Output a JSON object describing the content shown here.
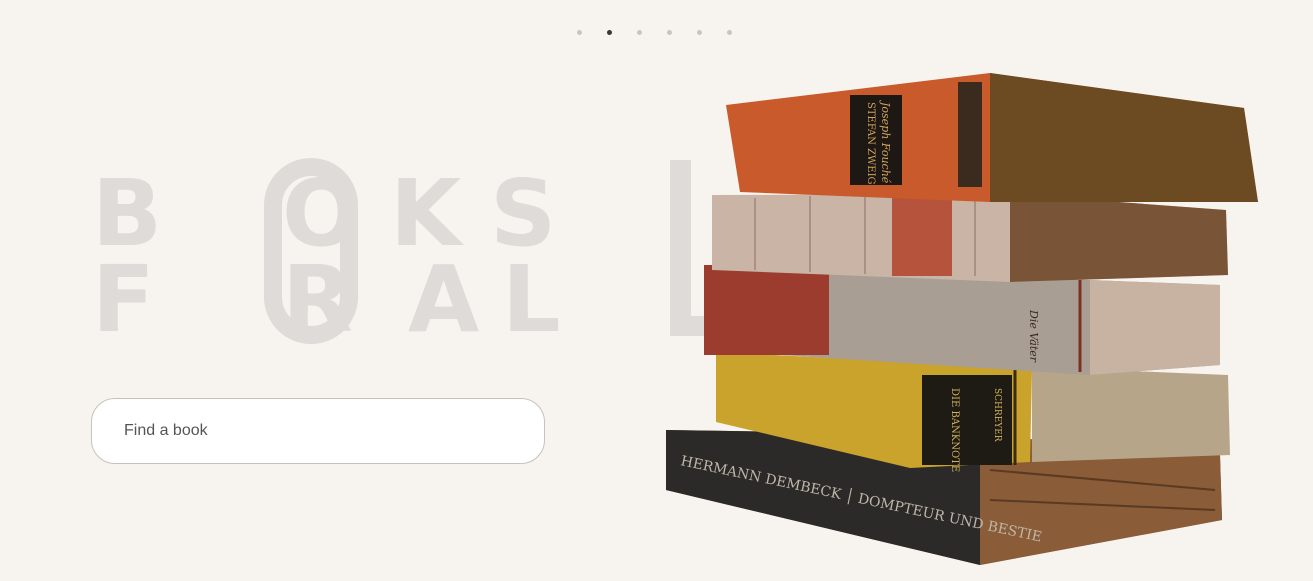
{
  "carousel": {
    "dot_count": 6,
    "active_index": 1
  },
  "hero": {
    "line1": [
      "B",
      "O",
      "K",
      "S"
    ],
    "line2": [
      "F",
      "R",
      "A",
      "L",
      "L"
    ],
    "shared_letter": "O",
    "text_color": "#dedbd8"
  },
  "search": {
    "placeholder": "Find a book"
  },
  "image": {
    "subject": "stack-of-old-books",
    "spine_texts": [
      "STEFAN ZWEIG Joseph Fouché",
      "Die Väter",
      "SCHREYER DIE BANKNOTE",
      "HERMANN DEMBECK DOMPTEUR UND BESTIE"
    ]
  },
  "colors": {
    "background": "#f7f3ee",
    "dot": "#c9c5c1",
    "dot_active": "#3b3735"
  }
}
